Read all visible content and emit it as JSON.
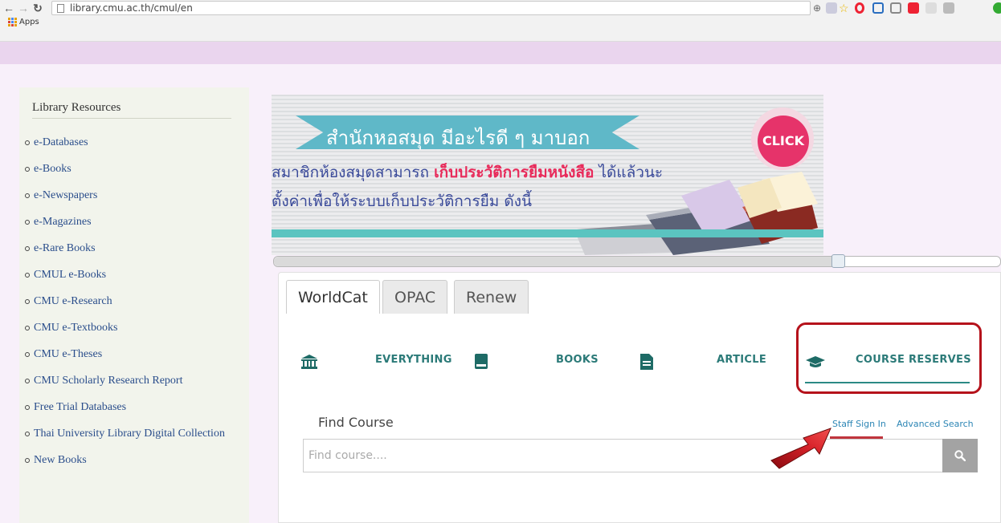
{
  "browser": {
    "url": "library.cmu.ac.th/cmul/en",
    "bookmarks_apps_label": "Apps"
  },
  "sidebar": {
    "title": "Library Resources",
    "items": [
      {
        "label": "e-Databases"
      },
      {
        "label": "e-Books"
      },
      {
        "label": "e-Newspapers"
      },
      {
        "label": "e-Magazines"
      },
      {
        "label": "e-Rare Books"
      },
      {
        "label": "CMUL e-Books"
      },
      {
        "label": "CMU e-Research"
      },
      {
        "label": "CMU e-Textbooks"
      },
      {
        "label": "CMU e-Theses"
      },
      {
        "label": "CMU Scholarly Research Report"
      },
      {
        "label": "Free Trial Databases"
      },
      {
        "label": "Thai University Library Digital Collection"
      },
      {
        "label": "New Books"
      }
    ]
  },
  "banner": {
    "headline": "สำนักหอสมุด มีอะไรดี ๆ มาบอก",
    "line1_pre": "สมาชิกห้องสมุดสามารถ ",
    "line1_highlight": "เก็บประวัติการยืมหนังสือ",
    "line1_post": " ได้แล้วนะ",
    "line2": "ตั้งค่าเพื่อให้ระบบเก็บประวัติการยืม ดังนี้",
    "click_label": "CLICK"
  },
  "slider": {
    "position_fraction": 0.78
  },
  "search": {
    "tabs": [
      {
        "label": "WorldCat",
        "active": true
      },
      {
        "label": "OPAC",
        "active": false
      },
      {
        "label": "Renew",
        "active": false
      }
    ],
    "categories": [
      {
        "label": "EVERYTHING",
        "icon": "institution-icon"
      },
      {
        "label": "BOOKS",
        "icon": "book-icon"
      },
      {
        "label": "ARTICLE",
        "icon": "document-icon"
      },
      {
        "label": "COURSE RESERVES",
        "icon": "graduation-cap-icon",
        "selected": true
      }
    ],
    "find_label": "Find Course",
    "staff_sign_in": "Staff Sign In",
    "advanced_search": "Advanced Search",
    "input_placeholder": "Find course...."
  },
  "colors": {
    "accent_teal": "#2b7a78",
    "annotation_red": "#b5121b",
    "link_blue": "#2d86b5",
    "page_band": "#ead5ee"
  }
}
